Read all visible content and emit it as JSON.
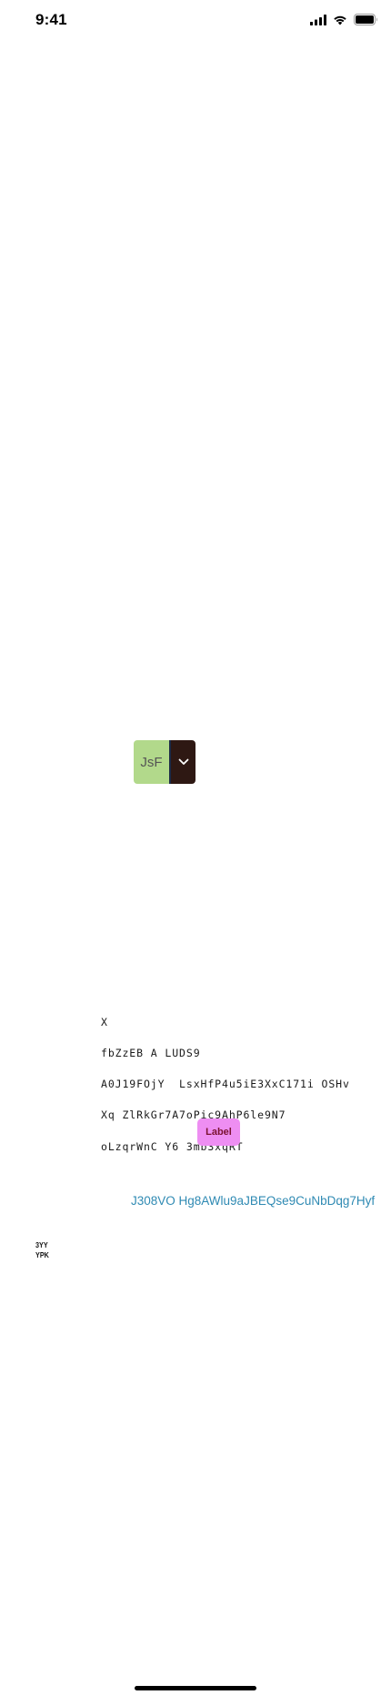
{
  "status_bar": {
    "time": "9:41",
    "icons": [
      "signal-icon",
      "wifi-icon",
      "battery-icon"
    ]
  },
  "split_button": {
    "label": "JsF",
    "toggle_icon": "chevron-down-icon",
    "colors": {
      "main_bg": "#b2d98b",
      "toggle_bg": "#2e1813",
      "divider": "#1b2a46"
    }
  },
  "text_block": {
    "lines": [
      "X",
      "fbZzEB A LUDS9",
      "A0J19FOjY  LsxHfP4u5iE3XxC171i OSHv",
      "Xq ZlRkGr7A7oPic9AhP6le9N7",
      "oLzqrWnC Y6 3mb3xqRT"
    ]
  },
  "label_button": {
    "label": "Label",
    "bg_color": "#ee8ef2",
    "text_color": "#7a1230"
  },
  "link": {
    "text": "J308VO  Hg8AWlu9aJBEQse9CuNbDqg7Hyf",
    "color": "#2f8ab3"
  },
  "small_text": {
    "lines": [
      "3YY",
      "YPK"
    ]
  }
}
